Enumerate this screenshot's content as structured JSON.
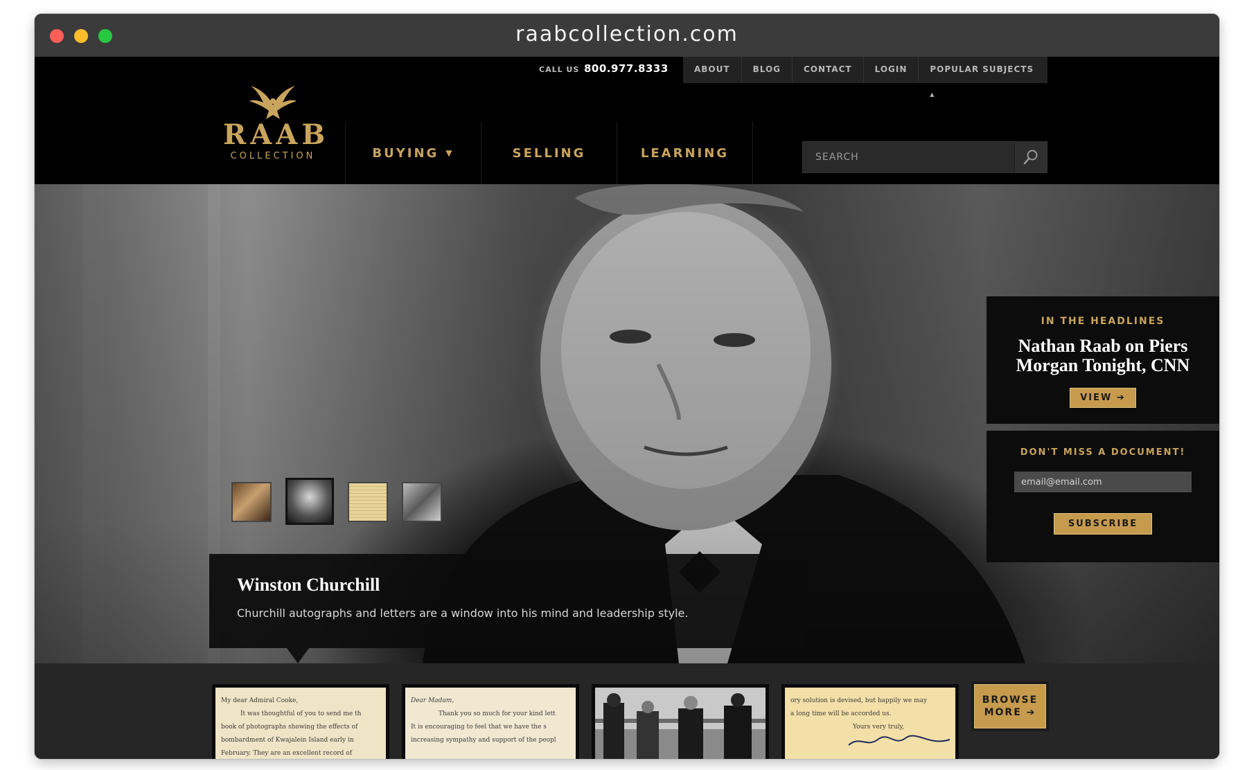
{
  "window": {
    "title": "raabcollection.com"
  },
  "header": {
    "call_label": "CALL US",
    "phone": "800.977.8333",
    "top_nav": [
      "ABOUT",
      "BLOG",
      "CONTACT",
      "LOGIN",
      "POPULAR SUBJECTS ▴"
    ],
    "logo": {
      "name": "RAAB",
      "sub": "COLLECTION"
    },
    "main_nav": [
      {
        "label": "BUYING",
        "caret": "▼"
      },
      {
        "label": "SELLING"
      },
      {
        "label": "LEARNING"
      }
    ],
    "search": {
      "placeholder": "SEARCH"
    }
  },
  "hero": {
    "title": "Winston Churchill",
    "description": "Churchill autographs and letters are a window into his mind and leadership style."
  },
  "headlines": {
    "heading": "IN THE HEADLINES",
    "title": "Nathan Raab on Piers Morgan Tonight, CNN",
    "button": "VIEW ➔"
  },
  "newsletter": {
    "heading": "DON'T MISS A DOCUMENT!",
    "email_placeholder": "email@email.com",
    "button": "SUBSCRIBE"
  },
  "strip": {
    "letter1": [
      "My dear Admiral Cooke,",
      "It was thoughtful of you to send me th",
      "book of photographs showing the effects of",
      "bombardment of Kwajalein Island early in",
      "February.  They are an excellent record of"
    ],
    "letter2": [
      "Dear Madam,",
      "Thank you so much for your kind lett",
      "It is encouraging to feel that we have the s",
      "increasing sympathy and support of the peopl"
    ],
    "letter4": [
      "ory solution is devised, but happily we may",
      "a long time will be accorded us.",
      "Yours very truly,"
    ],
    "browse": [
      "BROWSE",
      "MORE ➔"
    ]
  },
  "colors": {
    "accent_gold": "#c9a45c",
    "button_gold": "#c69b4e",
    "header_bg": "#000000",
    "strip_bg": "#262626"
  }
}
